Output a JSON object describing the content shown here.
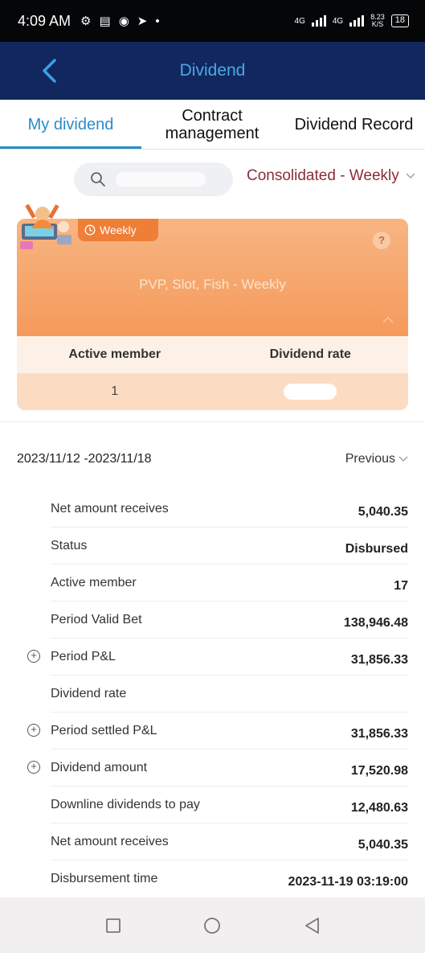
{
  "status_bar": {
    "time": "4:09 AM",
    "network1": "4G",
    "network2": "4G",
    "speed_value": "8.23",
    "speed_unit": "K/S",
    "battery": "18"
  },
  "app_bar": {
    "title": "Dividend"
  },
  "tabs": [
    {
      "label": "My dividend",
      "active": true
    },
    {
      "label": "Contract management",
      "active": false
    },
    {
      "label": "Dividend Record",
      "active": false
    }
  ],
  "search": {
    "placeholder": ""
  },
  "period_select": {
    "label": "Consolidated - Weekly"
  },
  "card": {
    "badge": "Weekly",
    "help": "?",
    "subtitle": "PVP, Slot, Fish - Weekly",
    "col1_header": "Active member",
    "col2_header": "Dividend rate",
    "col1_value": "1"
  },
  "period": {
    "range": "2023/11/12 -2023/11/18",
    "previous_label": "Previous"
  },
  "details": [
    {
      "label": "Net amount receives",
      "value": "5,040.35",
      "expandable": false
    },
    {
      "label": "Status",
      "value": "Disbursed",
      "expandable": false
    },
    {
      "label": "Active member",
      "value": "17",
      "expandable": false
    },
    {
      "label": "Period Valid Bet",
      "value": "138,946.48",
      "expandable": false
    },
    {
      "label": "Period P&L",
      "value": "31,856.33",
      "expandable": true
    },
    {
      "label": "Dividend rate",
      "value": "",
      "expandable": false
    },
    {
      "label": "Period settled P&L",
      "value": "31,856.33",
      "expandable": true
    },
    {
      "label": "Dividend amount",
      "value": "17,520.98",
      "expandable": true
    },
    {
      "label": "Downline dividends to pay",
      "value": "12,480.63",
      "expandable": false
    },
    {
      "label": "Net amount receives",
      "value": "5,040.35",
      "expandable": false
    },
    {
      "label": "Disbursement time",
      "value": "2023-11-19 03:19:00",
      "expandable": false
    }
  ],
  "colors": {
    "app_bar_bg": "#12275e",
    "title_blue": "#4aa8e8",
    "tab_active": "#2a8cc6",
    "card_orange": "#f59a5b",
    "select_text": "#8a2c3a"
  }
}
